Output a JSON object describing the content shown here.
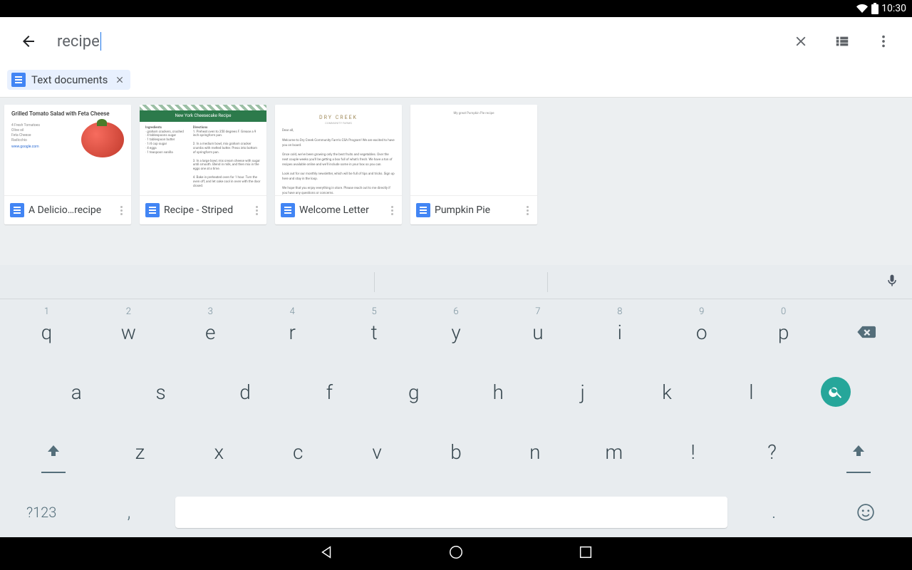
{
  "status": {
    "time": "10:30"
  },
  "search": {
    "query": "recipe"
  },
  "filter": {
    "chip_label": "Text documents"
  },
  "results": [
    {
      "title": "A Delicio…recipe",
      "thumb": {
        "heading": "Grilled Tomato Salad with Feta Cheese",
        "ingredients": "4 Fresh Tomatoes\nOlive oil\nFeta Cheese\nRadicchio",
        "link": "www.google.com"
      }
    },
    {
      "title": "Recipe - Striped",
      "thumb": {
        "banner": "New York Cheesecake Recipe",
        "col_left_hdr": "Ingredients",
        "col_right_hdr": "Directions"
      }
    },
    {
      "title": "Welcome Letter",
      "thumb": {
        "logo": "DRY CREEK",
        "sub": "COMMUNITY FARMS"
      }
    },
    {
      "title": "Pumpkin Pie",
      "thumb": {
        "tiny": "My great Pumpkin Pie recipe"
      }
    }
  ],
  "keyboard": {
    "row1": [
      {
        "k": "q",
        "h": "1"
      },
      {
        "k": "w",
        "h": "2"
      },
      {
        "k": "e",
        "h": "3"
      },
      {
        "k": "r",
        "h": "4"
      },
      {
        "k": "t",
        "h": "5"
      },
      {
        "k": "y",
        "h": "6"
      },
      {
        "k": "u",
        "h": "7"
      },
      {
        "k": "i",
        "h": "8"
      },
      {
        "k": "o",
        "h": "9"
      },
      {
        "k": "p",
        "h": "0"
      }
    ],
    "row2": [
      "a",
      "s",
      "d",
      "f",
      "g",
      "h",
      "j",
      "k",
      "l"
    ],
    "row3": [
      "z",
      "x",
      "c",
      "v",
      "b",
      "n",
      "m",
      "!",
      "?"
    ],
    "sym": "?123",
    "comma": ",",
    "period": "."
  }
}
